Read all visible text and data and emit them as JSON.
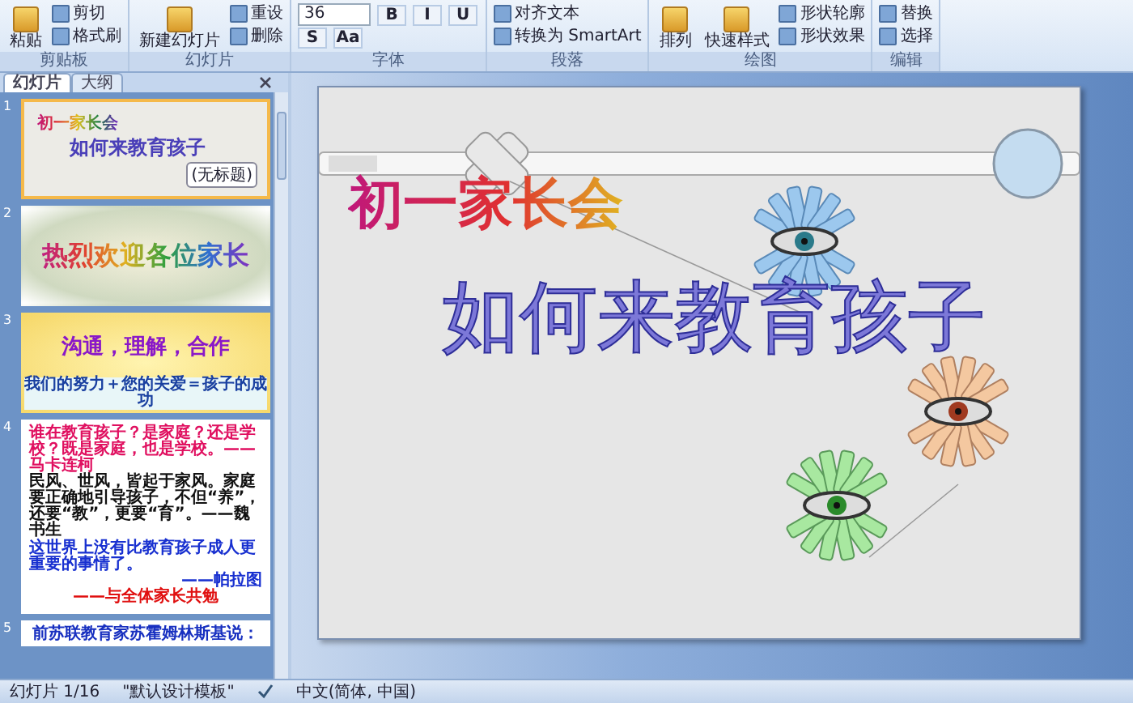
{
  "ribbon": {
    "groups": [
      {
        "label": "剪贴板",
        "items": [
          {
            "kind": "large",
            "label": "粘贴"
          },
          {
            "kind": "small",
            "label": "剪切"
          },
          {
            "kind": "small",
            "label": "格式刷"
          }
        ]
      },
      {
        "label": "幻灯片",
        "items": [
          {
            "kind": "large",
            "label": "新建幻灯片"
          },
          {
            "kind": "small",
            "label": "重设"
          },
          {
            "kind": "small",
            "label": "删除"
          }
        ]
      },
      {
        "label": "字体",
        "items": [
          {
            "kind": "field",
            "label": "36"
          },
          {
            "kind": "glyph",
            "label": "B"
          },
          {
            "kind": "glyph",
            "label": "I"
          },
          {
            "kind": "glyph",
            "label": "U"
          },
          {
            "kind": "glyph",
            "label": "S"
          },
          {
            "kind": "glyph",
            "label": "Aa"
          }
        ]
      },
      {
        "label": "段落",
        "items": [
          {
            "kind": "small",
            "label": "对齐文本"
          },
          {
            "kind": "small",
            "label": "转换为 SmartArt"
          }
        ]
      },
      {
        "label": "绘图",
        "items": [
          {
            "kind": "large",
            "label": "排列"
          },
          {
            "kind": "large",
            "label": "快速样式"
          },
          {
            "kind": "small",
            "label": "形状轮廓"
          },
          {
            "kind": "small",
            "label": "形状效果"
          }
        ]
      },
      {
        "label": "编辑",
        "items": [
          {
            "kind": "small",
            "label": "替换"
          },
          {
            "kind": "small",
            "label": "选择"
          }
        ]
      }
    ]
  },
  "pane": {
    "tabs": [
      {
        "label": "幻灯片",
        "selected": true
      },
      {
        "label": "大纲",
        "selected": false
      }
    ],
    "slides": [
      {
        "number": "1",
        "selected": true,
        "kind": "title",
        "texts": [
          "初一家长会",
          "如何来教育孩子",
          "(无标题)"
        ]
      },
      {
        "number": "2",
        "selected": false,
        "kind": "welcome",
        "texts": [
          "热烈欢迎各位家长"
        ]
      },
      {
        "number": "3",
        "selected": false,
        "kind": "motto",
        "texts": [
          "沟通，理解，合作",
          "我们的努力＋您的关爱＝孩子的成功"
        ]
      },
      {
        "number": "4",
        "selected": false,
        "kind": "quotes",
        "texts": [
          "谁在教育孩子？是家庭？还是学校？既是家庭，也是学校。——马卡连柯",
          "民风、世风，皆起于家风。家庭要正确地引导孩子，不但“养”，还要“教”，更要“育”。——魏书生",
          "这世界上没有比教育孩子成人更重要的事情了。",
          "——帕拉图",
          "——与全体家长共勉"
        ]
      },
      {
        "number": "5",
        "selected": false,
        "kind": "partial",
        "texts": [
          "前苏联教育家苏霍姆林斯基说："
        ]
      }
    ]
  },
  "slide": {
    "title": "初一家长会",
    "subtitle": "如何来教育孩子"
  },
  "status_bar": {
    "slide": "幻灯片 1/16",
    "theme": "\"默认设计模板\"",
    "language": "中文(简体, 中国)"
  }
}
